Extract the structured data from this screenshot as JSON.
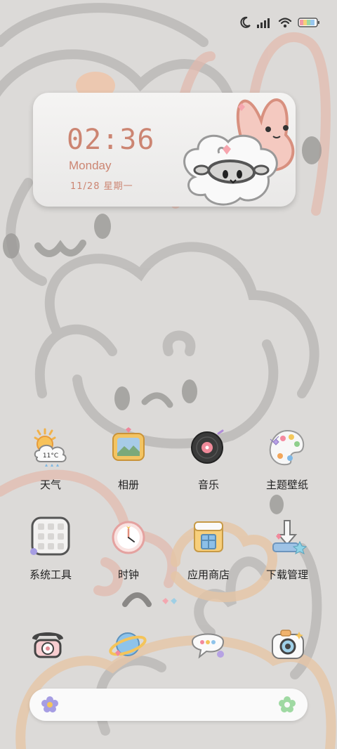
{
  "status_bar": {
    "icons": [
      "moon-icon",
      "signal-icon",
      "wifi-icon",
      "battery-icon"
    ]
  },
  "widget": {
    "time": "02:36",
    "day": "Monday",
    "date": "11/28 星期一"
  },
  "apps_row1": [
    {
      "name": "weather",
      "label": "天气",
      "icon": "weather-icon",
      "temp": "11°C"
    },
    {
      "name": "album",
      "label": "相册",
      "icon": "photo-frame-icon"
    },
    {
      "name": "music",
      "label": "音乐",
      "icon": "vinyl-record-icon"
    },
    {
      "name": "themes",
      "label": "主题壁纸",
      "icon": "paint-palette-icon"
    }
  ],
  "apps_row2": [
    {
      "name": "system-tools",
      "label": "系统工具",
      "icon": "folder-grid-icon"
    },
    {
      "name": "clock",
      "label": "时钟",
      "icon": "clock-icon"
    },
    {
      "name": "app-store",
      "label": "应用商店",
      "icon": "shop-icon"
    },
    {
      "name": "downloads",
      "label": "下载管理",
      "icon": "download-icon"
    }
  ],
  "dock": [
    {
      "name": "phone",
      "icon": "telephone-icon"
    },
    {
      "name": "browser",
      "icon": "planet-icon"
    },
    {
      "name": "messages",
      "icon": "chat-bubble-icon"
    },
    {
      "name": "camera",
      "icon": "camera-icon"
    }
  ],
  "search_bar": {
    "left_icon": "flower-icon",
    "right_icon": "flower-icon"
  },
  "colors": {
    "accent": "#cc8572",
    "background": "#dcdad8",
    "outline": "#b6b4b2"
  }
}
